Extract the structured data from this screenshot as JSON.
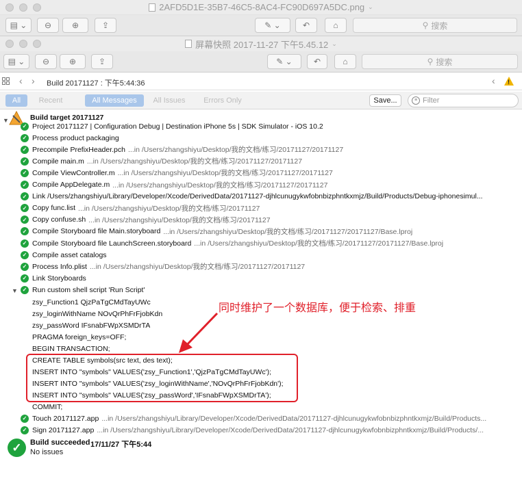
{
  "window1": {
    "title": "2AFD5D1E-35B7-46C5-8AC4-FC90D697A5DC.png",
    "search_placeholder": "搜索"
  },
  "window2": {
    "title": "屏幕快照 2017-11-27 下午5.45.12",
    "search_placeholder": "搜索"
  },
  "navbar": {
    "breadcrumb": "Build 20171127 : 下午5:44:36"
  },
  "filters": {
    "scope": [
      "All",
      "Recent"
    ],
    "types": [
      "All Messages",
      "All Issues",
      "Errors Only"
    ],
    "save_label": "Save...",
    "filter_placeholder": "Filter"
  },
  "log": {
    "target_title": "Build target 20171127",
    "steps": [
      {
        "msg": "Project 20171127 | Configuration Debug | Destination iPhone 5s | SDK Simulator - iOS 10.2",
        "path": ""
      },
      {
        "msg": "Process product packaging",
        "path": ""
      },
      {
        "msg": "Precompile PrefixHeader.pch",
        "path": "...in /Users/zhangshiyu/Desktop/我的文档/练习/20171127/20171127"
      },
      {
        "msg": "Compile main.m",
        "path": "...in /Users/zhangshiyu/Desktop/我的文档/练习/20171127/20171127"
      },
      {
        "msg": "Compile ViewController.m",
        "path": "...in /Users/zhangshiyu/Desktop/我的文档/练习/20171127/20171127"
      },
      {
        "msg": "Compile AppDelegate.m",
        "path": "...in /Users/zhangshiyu/Desktop/我的文档/练习/20171127/20171127"
      },
      {
        "msg": "Link /Users/zhangshiyu/Library/Developer/Xcode/DerivedData/20171127-djhlcunugykwfobnbizphntkxmjz/Build/Products/Debug-iphonesimul...",
        "path": ""
      },
      {
        "msg": "Copy func.list",
        "path": "...in /Users/zhangshiyu/Desktop/我的文档/练习/20171127"
      },
      {
        "msg": "Copy confuse.sh",
        "path": "...in /Users/zhangshiyu/Desktop/我的文档/练习/20171127"
      },
      {
        "msg": "Compile Storyboard file Main.storyboard",
        "path": "...in /Users/zhangshiyu/Desktop/我的文档/练习/20171127/20171127/Base.lproj"
      },
      {
        "msg": "Compile Storyboard file LaunchScreen.storyboard",
        "path": "...in /Users/zhangshiyu/Desktop/我的文档/练习/20171127/20171127/Base.lproj"
      },
      {
        "msg": "Compile asset catalogs",
        "path": ""
      },
      {
        "msg": "Process Info.plist",
        "path": "...in /Users/zhangshiyu/Desktop/我的文档/练习/20171127/20171127"
      },
      {
        "msg": "Link Storyboards",
        "path": ""
      },
      {
        "msg": "Run custom shell script 'Run Script'",
        "path": ""
      }
    ],
    "script_output": [
      "zsy_Function1 QjzPaTgCMdTayUWc",
      "zsy_loginWithName NOvQrPhFrFjobKdn",
      "zsy_passWord IFsnabFWpXSMDrTA",
      "PRAGMA foreign_keys=OFF;",
      "BEGIN TRANSACTION;",
      "CREATE TABLE symbols(src text, des text);",
      "INSERT INTO \"symbols\" VALUES('zsy_Function1','QjzPaTgCMdTayUWc');",
      "INSERT INTO \"symbols\" VALUES('zsy_loginWithName','NOvQrPhFrFjobKdn');",
      "INSERT INTO \"symbols\" VALUES('zsy_passWord','IFsnabFWpXSMDrTA');",
      "COMMIT;"
    ],
    "final_steps": [
      {
        "msg": "Touch 20171127.app",
        "path": "...in /Users/zhangshiyu/Library/Developer/Xcode/DerivedData/20171127-djhlcunugykwfobnbizphntkxmjz/Build/Products..."
      },
      {
        "msg": "Sign 20171127.app",
        "path": "...in /Users/zhangshiyu/Library/Developer/Xcode/DerivedData/20171127-djhlcunugykwfobnbizphntkxmjz/Build/Products/..."
      }
    ],
    "result": "Build succeeded",
    "result_time": "17/11/27 下午5:44",
    "issues": "No issues"
  },
  "annotation": {
    "text": "同时维护了一个数据库，便于检索、排重",
    "color": "#e0202a"
  },
  "colors": {
    "success": "#1fa33d",
    "filter_active": "#a9c6ea",
    "warning": "#f0b500"
  }
}
